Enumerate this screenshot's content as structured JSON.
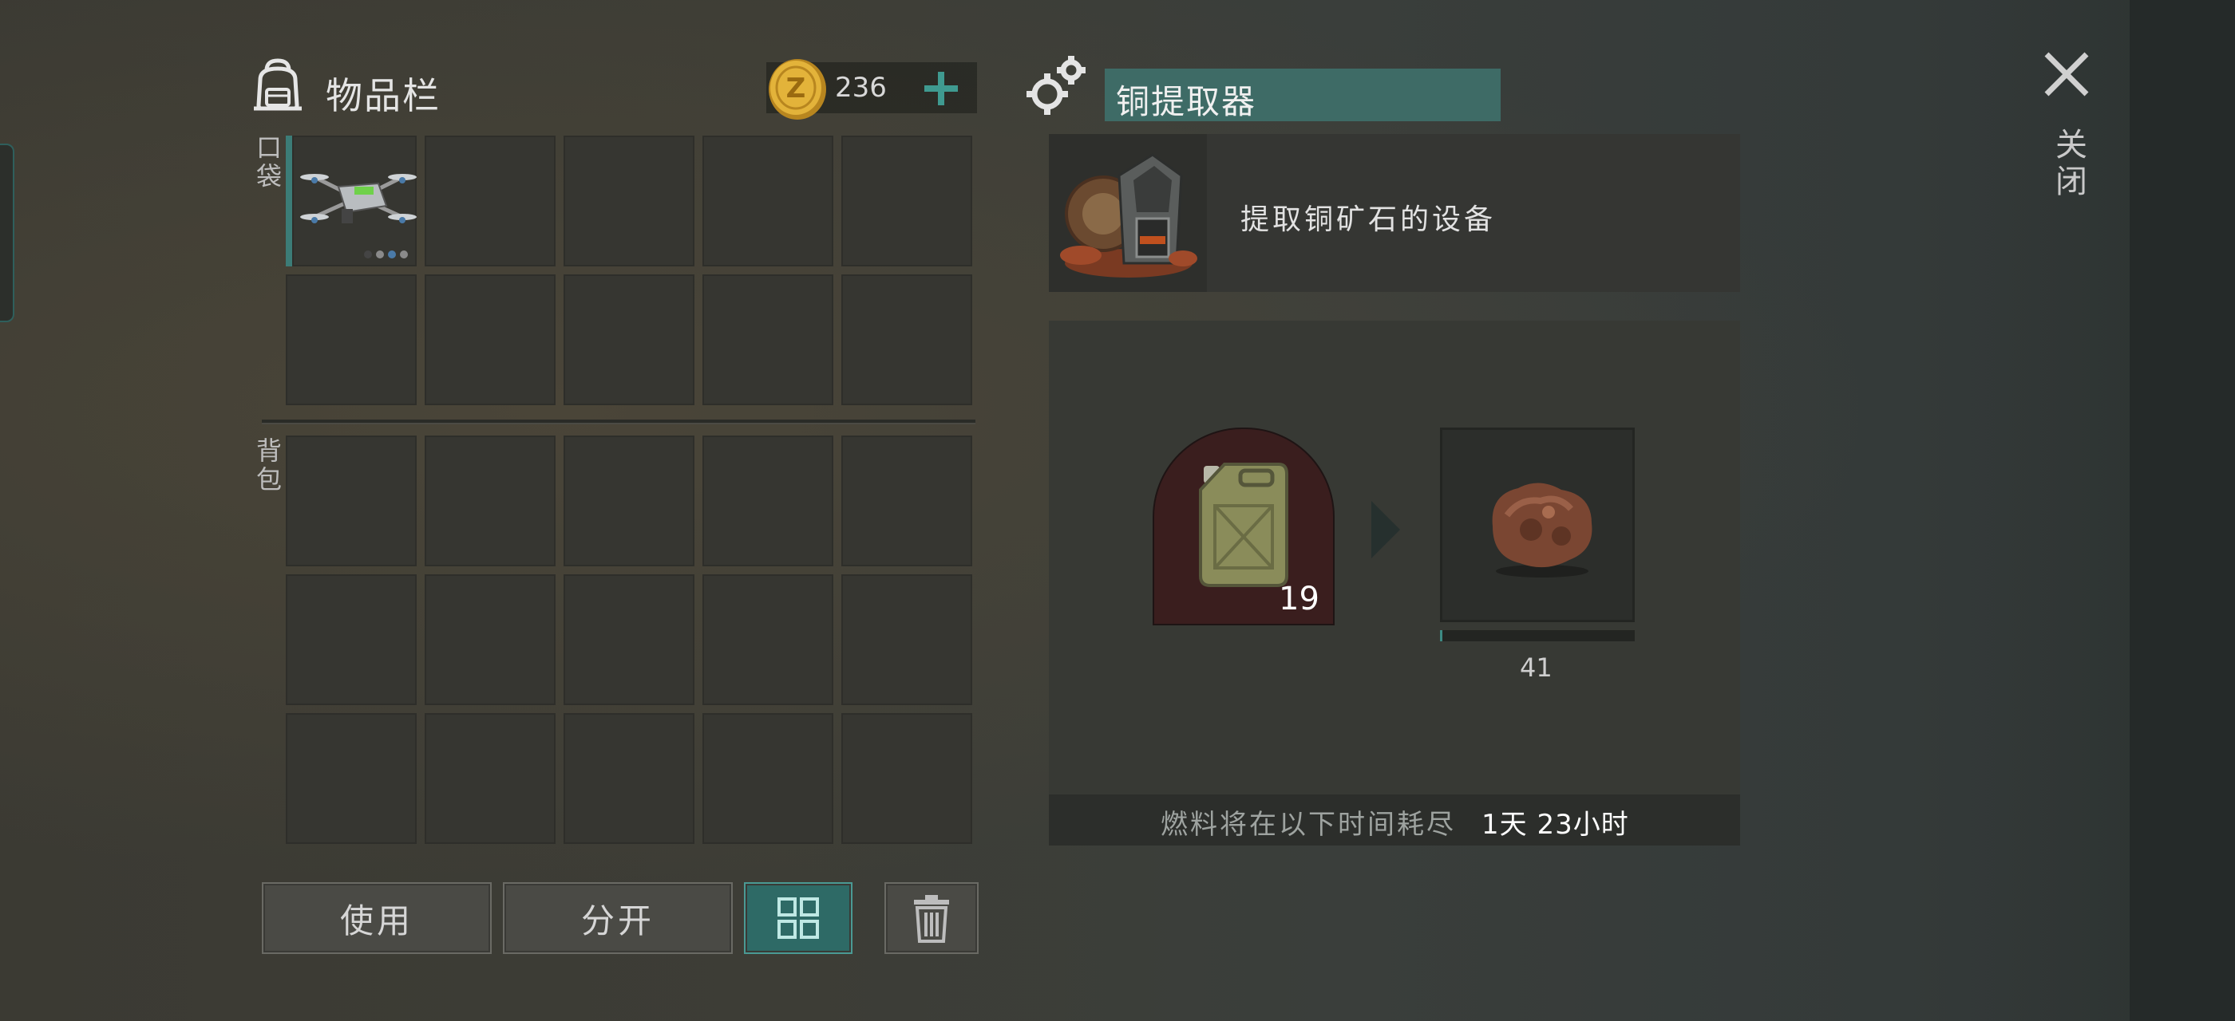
{
  "inventory": {
    "title": "物品栏",
    "coins": "236",
    "pocket_label": "口袋",
    "backpack_label": "背包",
    "pocket_items": [
      {
        "slot": 0,
        "item": "drone",
        "selected": true
      }
    ],
    "backpack_items": []
  },
  "actions": {
    "use_label": "使用",
    "split_label": "分开"
  },
  "device": {
    "name": "铜提取器",
    "description": "提取铜矿石的设备",
    "fuel_count": "19",
    "output_count": "41",
    "progress_fraction": 0.01,
    "fuel_status_label": "燃料将在以下时间耗尽",
    "fuel_time_left": "1天 23小时"
  },
  "close_label": "关闭",
  "colors": {
    "accent": "#3e6b66",
    "progress": "#3d8a83",
    "fuel_slot": "#3a1e1e",
    "coin": "#d9a92f"
  },
  "icons": [
    "backpack-icon",
    "coin-icon",
    "plus-icon",
    "drone-icon",
    "sort-icon",
    "trash-icon",
    "gear-icon",
    "extractor-icon",
    "fuel-canister-icon",
    "arrow-right-icon",
    "copper-ore-icon",
    "close-icon"
  ]
}
